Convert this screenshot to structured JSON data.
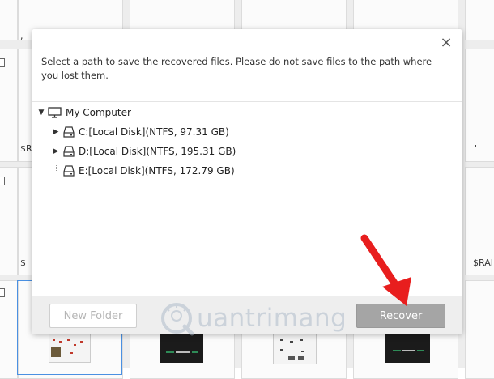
{
  "background": {
    "labels": {
      "r_tl": ",",
      "r2_left": "$R/",
      "r2_right": "'",
      "r3_left": "$",
      "r3_right": "$RAI"
    }
  },
  "dialog": {
    "close_icon": "×",
    "instructions": "Select a path to save the recovered files. Please do not save files to the path where you lost them.",
    "tree": {
      "root": {
        "label": "My Computer",
        "icon": "computer-icon"
      },
      "drives": [
        {
          "label": "C:[Local Disk](NTFS, 97.31 GB)",
          "icon": "disk-icon"
        },
        {
          "label": "D:[Local Disk](NTFS, 195.31 GB)",
          "icon": "disk-icon"
        },
        {
          "label": "E:[Local Disk](NTFS, 172.79 GB)",
          "icon": "disk-icon"
        }
      ]
    },
    "buttons": {
      "new_folder": "New Folder",
      "recover": "Recover"
    }
  },
  "watermark": {
    "text": "uantrimang",
    "logo_letter": "Q"
  },
  "colors": {
    "recover_button": "#a5a5a5",
    "annotation_arrow": "#e81e1e",
    "selection_border": "#4a90e2"
  }
}
